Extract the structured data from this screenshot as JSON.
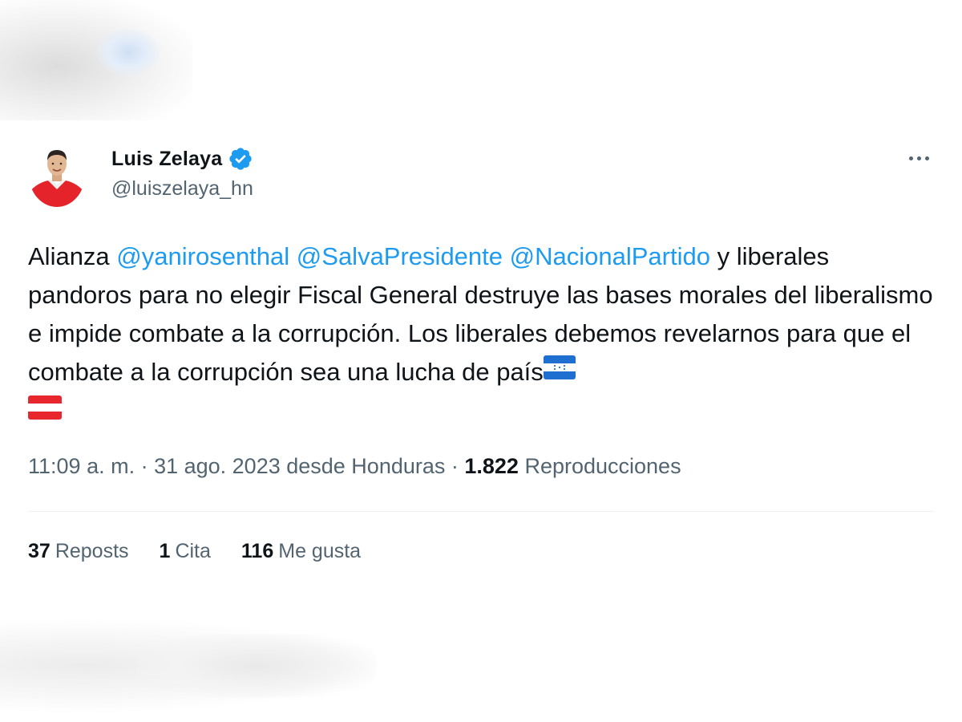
{
  "tweet": {
    "author": {
      "display_name": "Luis Zelaya",
      "handle": "@luiszelaya_hn",
      "verified": true,
      "verified_color": "#1d9bf0"
    },
    "body": {
      "prefix": "Alianza ",
      "mentions": [
        "@yanirosenthal",
        "@SalvaPresidente",
        "@NacionalPartido"
      ],
      "text": " y liberales pandoros para no elegir Fiscal General destruye las bases morales del liberalismo e impide combate a la corrupción. Los liberales debemos revelarnos para que el combate a la corrupción sea una lucha de país",
      "emojis": [
        "honduras-flag-icon",
        "red-white-flag-icon"
      ]
    },
    "meta": {
      "time": "11:09 a. m.",
      "separator1": " · ",
      "date": "31 ago. 2023",
      "location": " desde Honduras",
      "separator2": " · ",
      "views_count": "1.822",
      "views_label": " Reproducciones"
    },
    "stats": {
      "reposts_count": "37",
      "reposts_label": "Reposts",
      "quotes_count": "1",
      "quotes_label": "Cita",
      "likes_count": "116",
      "likes_label": "Me gusta"
    }
  },
  "colors": {
    "link": "#1d9bf0",
    "text_primary": "#0f1419",
    "text_secondary": "#536471"
  }
}
